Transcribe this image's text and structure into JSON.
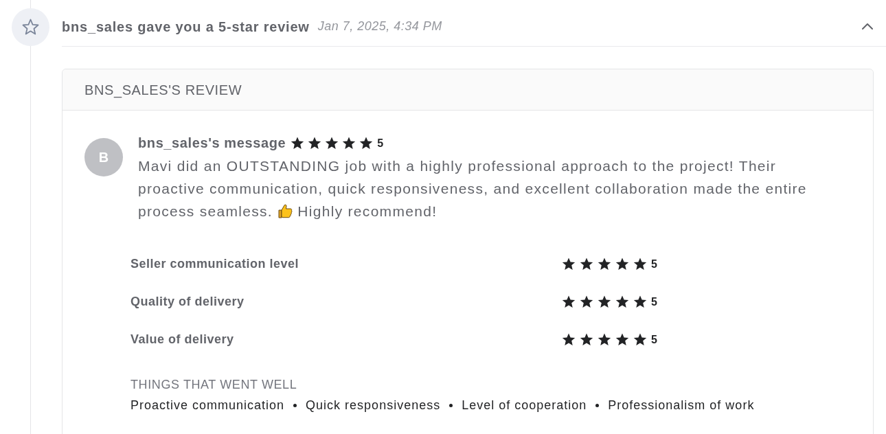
{
  "notification": {
    "title": "bns_sales gave you a 5-star review",
    "time": "Jan 7, 2025, 4:34 PM",
    "expanded": true
  },
  "review": {
    "heading": "BNS_SALES'S REVIEW",
    "avatar_initial": "B",
    "author_label": "bns_sales's message",
    "stars": 5,
    "rating": "5",
    "message": "Mavi did an OUTSTANDING job with a highly professional approach to the project! Their proactive communication, quick responsiveness, and excellent collaboration made the entire process seamless.",
    "message_end": "Highly recommend!",
    "criteria": [
      {
        "label": "Seller communication level",
        "stars": 5,
        "rating": "5"
      },
      {
        "label": "Quality of delivery",
        "stars": 5,
        "rating": "5"
      },
      {
        "label": "Value of delivery",
        "stars": 5,
        "rating": "5"
      }
    ],
    "highlights": {
      "heading": "THINGS THAT WENT WELL",
      "items": [
        "Proactive communication",
        "Quick responsiveness",
        "Level of cooperation",
        "Professionalism of work"
      ]
    }
  }
}
